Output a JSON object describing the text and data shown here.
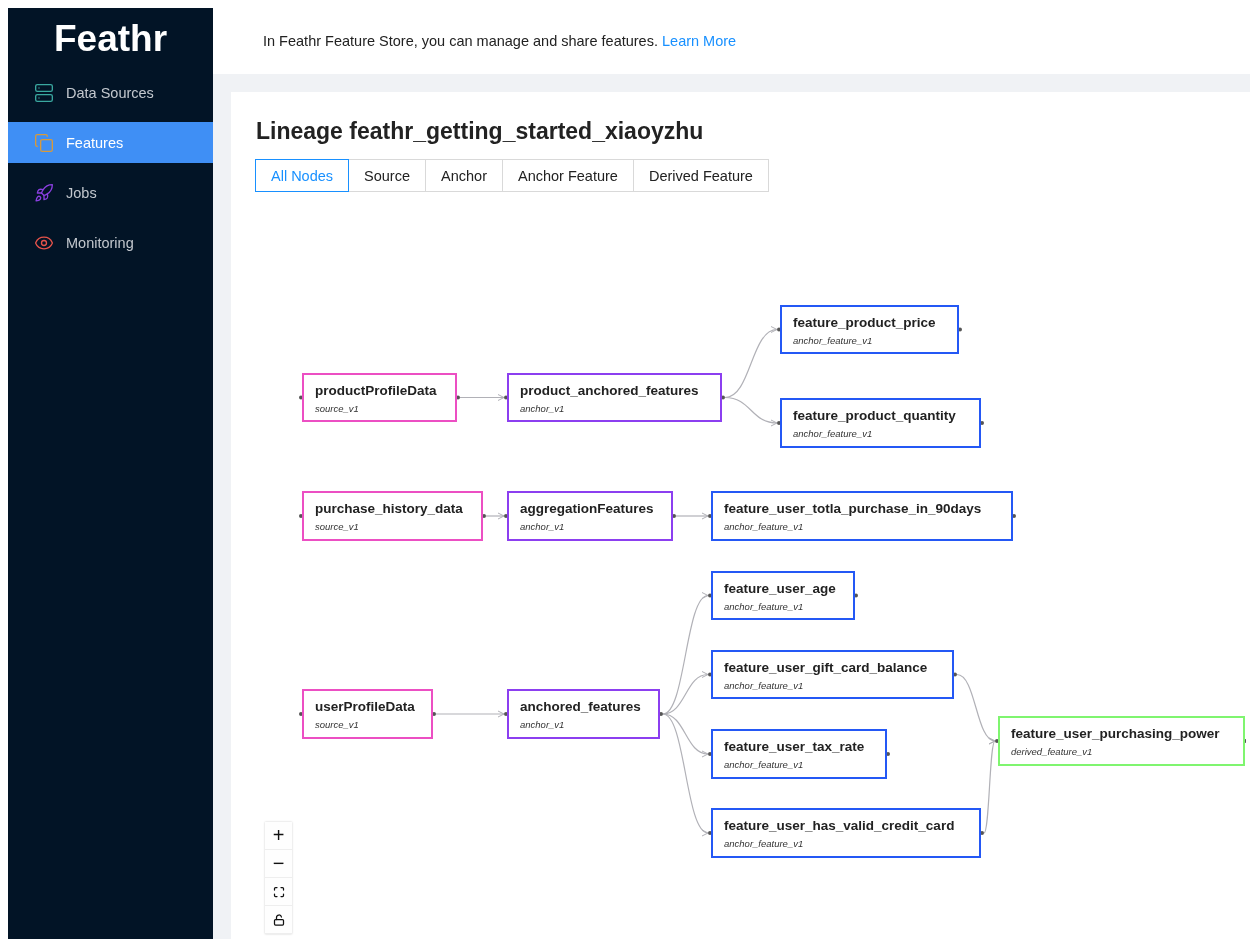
{
  "sidebar": {
    "logo": "Feathr",
    "items": [
      {
        "label": "Data Sources",
        "kind": "sources",
        "selected": false
      },
      {
        "label": "Features",
        "kind": "features",
        "selected": true
      },
      {
        "label": "Jobs",
        "kind": "jobs",
        "selected": false
      },
      {
        "label": "Monitoring",
        "kind": "monitoring",
        "selected": false
      }
    ]
  },
  "header": {
    "text": "In Feathr Feature Store, you can manage and share features.",
    "link": "Learn More"
  },
  "page": {
    "title": "Lineage feathr_getting_started_xiaoyzhu",
    "tabs": [
      {
        "label": "All Nodes",
        "selected": true
      },
      {
        "label": "Source",
        "selected": false
      },
      {
        "label": "Anchor",
        "selected": false
      },
      {
        "label": "Anchor Feature",
        "selected": false
      },
      {
        "label": "Derived Feature",
        "selected": false
      }
    ]
  },
  "graph": {
    "nodes": [
      {
        "label": "productProfileData",
        "subtitle": "source_v1",
        "kind": "source"
      },
      {
        "label": "product_anchored_features",
        "subtitle": "anchor_v1",
        "kind": "anchor"
      },
      {
        "label": "feature_product_price",
        "subtitle": "anchor_feature_v1",
        "kind": "feature"
      },
      {
        "label": "feature_product_quantity",
        "subtitle": "anchor_feature_v1",
        "kind": "feature"
      },
      {
        "label": "purchase_history_data",
        "subtitle": "source_v1",
        "kind": "source"
      },
      {
        "label": "aggregationFeatures",
        "subtitle": "anchor_v1",
        "kind": "anchor"
      },
      {
        "label": "feature_user_totla_purchase_in_90days",
        "subtitle": "anchor_feature_v1",
        "kind": "feature"
      },
      {
        "label": "feature_user_age",
        "subtitle": "anchor_feature_v1",
        "kind": "feature"
      },
      {
        "label": "feature_user_gift_card_balance",
        "subtitle": "anchor_feature_v1",
        "kind": "feature"
      },
      {
        "label": "userProfileData",
        "subtitle": "source_v1",
        "kind": "source"
      },
      {
        "label": "anchored_features",
        "subtitle": "anchor_v1",
        "kind": "anchor"
      },
      {
        "label": "feature_user_tax_rate",
        "subtitle": "anchor_feature_v1",
        "kind": "feature"
      },
      {
        "label": "feature_user_has_valid_credit_card",
        "subtitle": "anchor_feature_v1",
        "kind": "feature"
      },
      {
        "label": "feature_user_purchasing_power",
        "subtitle": "derived_feature_v1",
        "kind": "derived"
      }
    ],
    "controls": [
      "+",
      "−"
    ]
  }
}
